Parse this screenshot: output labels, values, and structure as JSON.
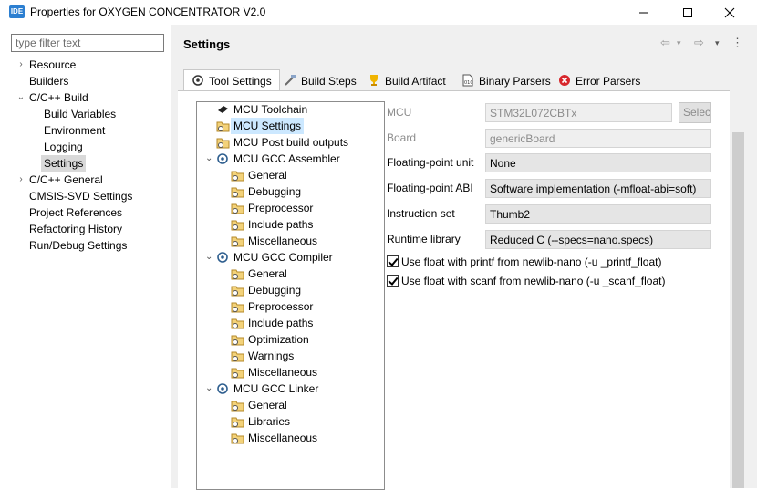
{
  "window": {
    "icon_text": "IDE",
    "title": "Properties for OXYGEN CONCENTRATOR V2.0"
  },
  "filter": {
    "placeholder": "type filter text",
    "value": ""
  },
  "nav": {
    "resource": "Resource",
    "builders": "Builders",
    "cc_build": "C/C++ Build",
    "build_variables": "Build Variables",
    "environment": "Environment",
    "logging": "Logging",
    "settings": "Settings",
    "cc_general": "C/C++ General",
    "cmsis_svd": "CMSIS-SVD Settings",
    "project_references": "Project References",
    "refactoring_history": "Refactoring History",
    "run_debug": "Run/Debug Settings"
  },
  "page": {
    "title": "Settings"
  },
  "tabs": {
    "tool_settings": "Tool Settings",
    "build_steps": "Build Steps",
    "build_artifact": "Build Artifact",
    "binary_parsers": "Binary Parsers",
    "error_parsers": "Error Parsers"
  },
  "tree": {
    "mcu_toolchain": "MCU Toolchain",
    "mcu_settings": "MCU Settings",
    "mcu_post_build": "MCU Post build outputs",
    "assembler": "MCU GCC Assembler",
    "asm_general": "General",
    "asm_debugging": "Debugging",
    "asm_preprocessor": "Preprocessor",
    "asm_include": "Include paths",
    "asm_misc": "Miscellaneous",
    "compiler": "MCU GCC Compiler",
    "cc_general": "General",
    "cc_debugging": "Debugging",
    "cc_preprocessor": "Preprocessor",
    "cc_include": "Include paths",
    "cc_optimization": "Optimization",
    "cc_warnings": "Warnings",
    "cc_misc": "Miscellaneous",
    "linker": "MCU GCC Linker",
    "ld_general": "General",
    "ld_libraries": "Libraries",
    "ld_misc": "Miscellaneous"
  },
  "form": {
    "mcu_label": "MCU",
    "mcu_value": "STM32L072CBTx",
    "select_label": "Select",
    "board_label": "Board",
    "board_value": "genericBoard",
    "fpu_label": "Floating-point unit",
    "fpu_value": "None",
    "fpabi_label": "Floating-point ABI",
    "fpabi_value": "Software implementation (-mfloat-abi=soft)",
    "iset_label": "Instruction set",
    "iset_value": "Thumb2",
    "runtime_label": "Runtime library",
    "runtime_value": "Reduced C (--specs=nano.specs)",
    "printf_label": "Use float with printf from newlib-nano (-u _printf_float)",
    "scanf_label": "Use float with scanf from newlib-nano (-u _scanf_float)",
    "printf_checked": true,
    "scanf_checked": true
  },
  "colors": {
    "selection": "#cce8ff",
    "nav_selection": "#d9d9d9",
    "panel_bg": "#f0f0f0",
    "field_bg": "#e5e5e5"
  }
}
